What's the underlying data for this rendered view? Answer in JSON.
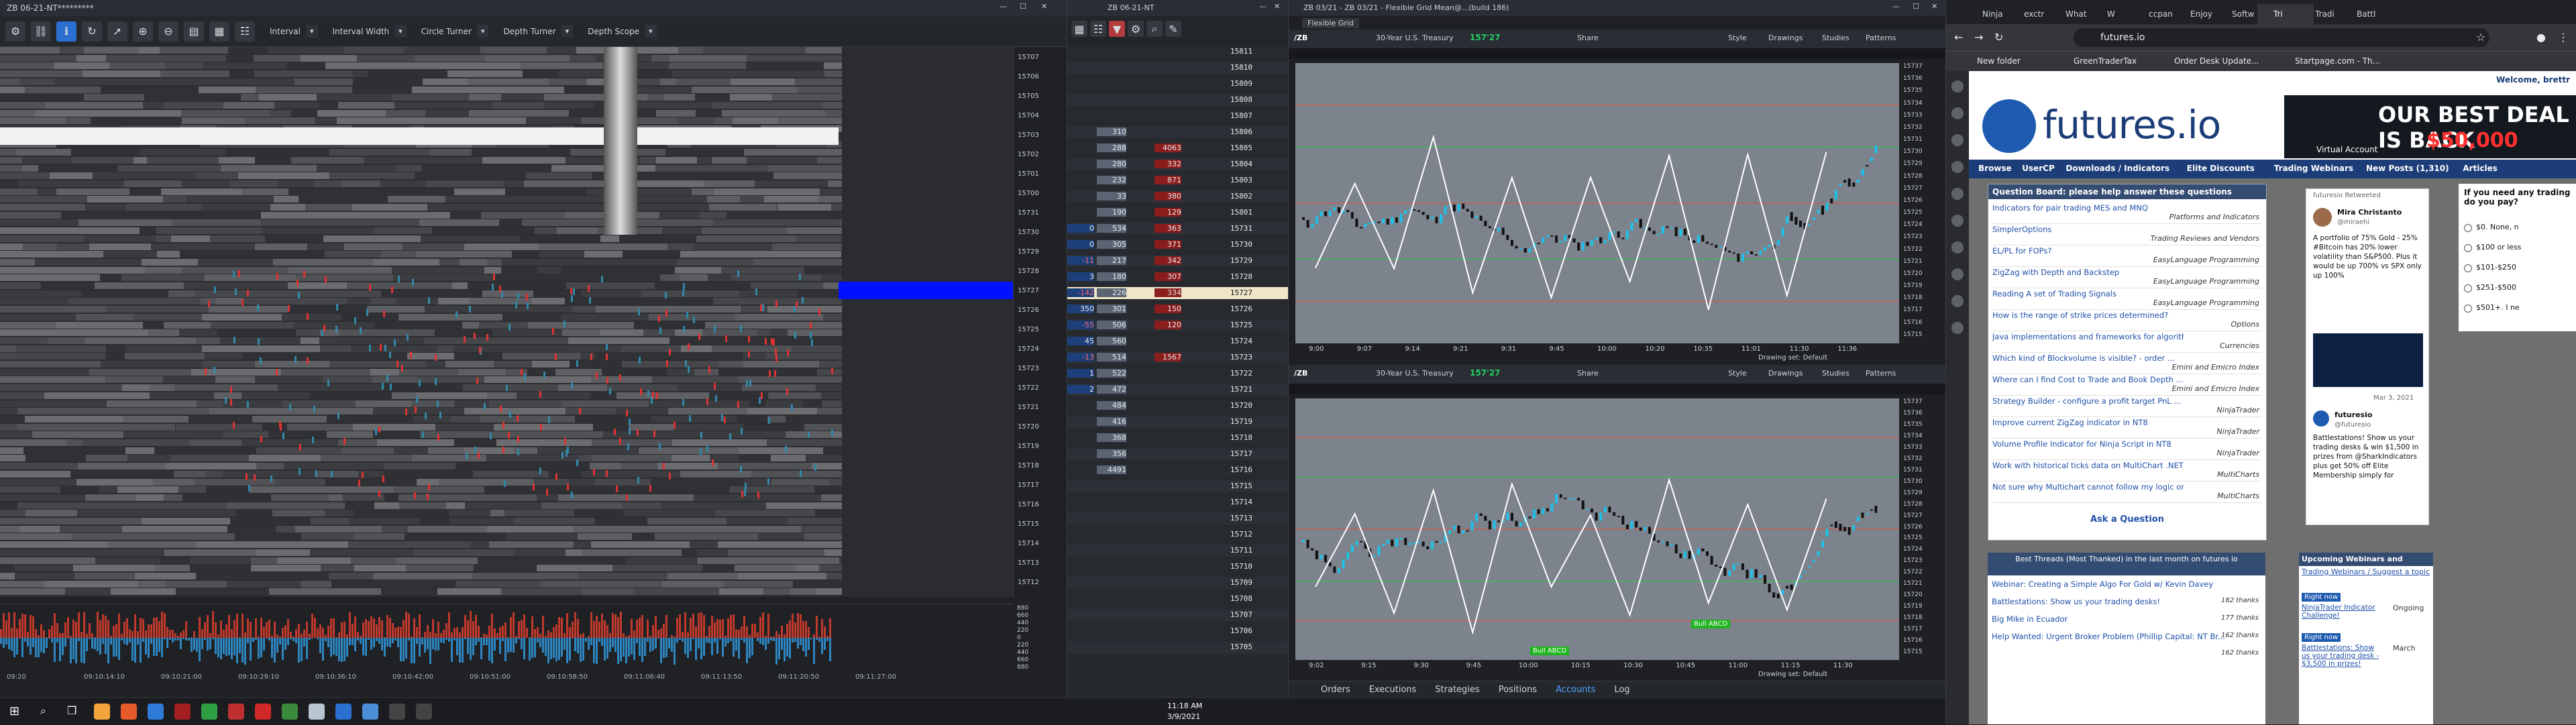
{
  "heatmap": {
    "title": "ZB 06-21-NT*********",
    "toolbar": {
      "interval_label": "Interval",
      "interval_width_label": "Interval Width",
      "circle_turner_label": "Circle Turner",
      "depth_turner_label": "Depth Turner",
      "depth_scope_label": "Depth Scope"
    },
    "price_labels": [
      "15707",
      "15706",
      "15705",
      "15704",
      "15703",
      "15702",
      "15701",
      "15700",
      "15731",
      "15730",
      "15729",
      "15728",
      "15727",
      "15726",
      "15725",
      "15724",
      "15723",
      "15722",
      "15721",
      "15720",
      "15719",
      "15718",
      "15717",
      "15716",
      "15715",
      "15714",
      "15713",
      "15712"
    ],
    "volume_labels": [
      "880",
      "660",
      "440",
      "220",
      "0",
      "220",
      "440",
      "660",
      "880"
    ],
    "time_labels": [
      "09:20",
      "09:10:14:10",
      "09:10:21:00",
      "09:10:29:10",
      "09:10:36:10",
      "09:10:42:00",
      "09:10:51:00",
      "09:10:58:50",
      "09:11:06:40",
      "09:11:13:50",
      "09:11:20:50",
      "09:11:27:00"
    ]
  },
  "ladder": {
    "title": "ZB 06-21-NT",
    "rows": [
      {
        "bid": "",
        "ask": "",
        "price": "15811"
      },
      {
        "bid": "",
        "ask": "",
        "price": "15810"
      },
      {
        "bid": "",
        "ask": "",
        "price": "15809"
      },
      {
        "bid": "",
        "ask": "",
        "price": "15808"
      },
      {
        "bid": "",
        "ask": "",
        "price": "15807"
      },
      {
        "bid": "",
        "ask": "310",
        "vol": "",
        "price": "15806"
      },
      {
        "bid": "",
        "ask": "288",
        "vol": "4063",
        "price": "15805"
      },
      {
        "bid": "",
        "ask": "280",
        "vol": "332",
        "price": "15804"
      },
      {
        "bid": "",
        "ask": "232",
        "vol": "871",
        "price": "15803"
      },
      {
        "bid": "",
        "ask": "33",
        "vol": "380",
        "price": "15802"
      },
      {
        "bid": "",
        "ask": "190",
        "vol": "129",
        "price": "15801"
      },
      {
        "bid": "0",
        "ask": "534",
        "vol": "363",
        "price": "15731"
      },
      {
        "bid": "0",
        "ask": "305",
        "vol": "371",
        "price": "15730"
      },
      {
        "bid": "-11",
        "ask": "217",
        "vol": "342",
        "price": "15729"
      },
      {
        "bid": "3",
        "ask": "180",
        "vol": "307",
        "price": "15728"
      },
      {
        "bid": "-142",
        "ask": "226",
        "vol": "334",
        "price": "15727"
      },
      {
        "bid": "350",
        "ask": "301",
        "vol": "150",
        "price": "15726"
      },
      {
        "bid": "-55",
        "ask": "506",
        "vol": "120",
        "price": "15725"
      },
      {
        "bid": "45",
        "ask": "560",
        "vol": "",
        "price": "15724"
      },
      {
        "bid": "-13",
        "ask": "514",
        "vol": "1567",
        "price": "15723"
      },
      {
        "bid": "1",
        "ask": "522",
        "vol": "",
        "price": "15722"
      },
      {
        "bid": "2",
        "ask": "472",
        "vol": "",
        "price": "15721"
      },
      {
        "bid": "",
        "ask": "484",
        "vol": "",
        "price": "15720"
      },
      {
        "bid": "",
        "ask": "416",
        "vol": "",
        "price": "15719"
      },
      {
        "bid": "",
        "ask": "368",
        "vol": "",
        "price": "15718"
      },
      {
        "bid": "",
        "ask": "356",
        "vol": "",
        "price": "15717"
      },
      {
        "bid": "",
        "ask": "4491",
        "vol": "",
        "price": "15716"
      },
      {
        "bid": "",
        "ask": "",
        "vol": "",
        "price": "15715"
      },
      {
        "bid": "",
        "ask": "",
        "vol": "",
        "price": "15714"
      },
      {
        "bid": "",
        "ask": "",
        "vol": "",
        "price": "15713"
      },
      {
        "bid": "",
        "ask": "",
        "vol": "",
        "price": "15712"
      },
      {
        "bid": "",
        "ask": "",
        "vol": "",
        "price": "15711"
      },
      {
        "bid": "",
        "ask": "",
        "vol": "",
        "price": "15710"
      },
      {
        "bid": "",
        "ask": "",
        "vol": "",
        "price": "15709"
      },
      {
        "bid": "",
        "ask": "",
        "vol": "",
        "price": "15708"
      },
      {
        "bid": "",
        "ask": "",
        "vol": "",
        "price": "15707"
      },
      {
        "bid": "",
        "ask": "",
        "vol": "",
        "price": "15706"
      },
      {
        "bid": "",
        "ask": "",
        "vol": "",
        "price": "15705"
      }
    ]
  },
  "charts": {
    "top": {
      "title": "ZB 03/21 - ZB 03/21 - Flexible Grid Mean@...(build 186)",
      "tab": "Flexible Grid",
      "symbol": "30-Year U.S. Treasury",
      "last": "157'27",
      "share": "Share",
      "style": "Style",
      "drawings": "Drawings",
      "studies": "Studies",
      "patterns": "Patterns",
      "prices": [
        "15737",
        "15736",
        "15735",
        "15734",
        "15733",
        "15732",
        "15731",
        "15730",
        "15729",
        "15728",
        "15727",
        "15726",
        "15725",
        "15724",
        "15723",
        "15722",
        "15721",
        "15720",
        "15719",
        "15718",
        "15717",
        "15716",
        "15715"
      ],
      "times": [
        "9:00",
        "9:07",
        "9:14",
        "9:21",
        "9:31",
        "9:45",
        "10:00",
        "10:20",
        "10:35",
        "11:01",
        "11:30",
        "11:36"
      ],
      "status": "Drawing set: Default"
    },
    "bottom": {
      "symbol": "30-Year U.S. Treasury",
      "last": "157'27",
      "prices": [
        "15737",
        "15736",
        "15735",
        "15734",
        "15733",
        "15732",
        "15731",
        "15730",
        "15729",
        "15728",
        "15727",
        "15726",
        "15725",
        "15724",
        "15723",
        "15722",
        "15721",
        "15720",
        "15719",
        "15718",
        "15717",
        "15716",
        "15715"
      ],
      "times": [
        "9:02",
        "9:15",
        "9:30",
        "9:45",
        "10:00",
        "10:15",
        "10:30",
        "10:45",
        "11:00",
        "11:15",
        "11:30"
      ],
      "labels": [
        "Bull ABCD",
        "Bull ABCD"
      ],
      "status": "Drawing set: Default"
    },
    "panel_tabs": [
      "Orders",
      "Executions",
      "Strategies",
      "Positions",
      "Accounts",
      "Log"
    ]
  },
  "taskbar": {
    "time": "11:18 AM",
    "date": "3/9/2021"
  },
  "browser": {
    "tabs": [
      "Ninja",
      "exctr",
      "What",
      "W",
      "ccpan",
      "Enjoy",
      "Softw",
      "Tri",
      "Tradi",
      "Battl"
    ],
    "url": "futures.io",
    "bookmarks": [
      "New folder",
      "GreenTraderTax",
      "Order Desk Update...",
      "Startpage.com - Th..."
    ],
    "site": {
      "logo": "futures.io",
      "welcome": "Welcome, brettr",
      "ad_headline": "OUR BEST DEAL IS BACK",
      "ad_price": "$50,000",
      "ad_sub": "Virtual Account",
      "nav": [
        "Browse",
        "UserCP",
        "Downloads / Indicators",
        "Elite Discounts",
        "Trading Webinars",
        "New Posts (1,310)",
        "Articles"
      ],
      "question_board_title": "Question Board: please help answer these questions",
      "questions": [
        {
          "title": "Indicators for pair trading MES and MNQ",
          "cat": "Platforms and Indicators"
        },
        {
          "title": "SimplerOptions",
          "cat": "Trading Reviews and Vendors"
        },
        {
          "title": "EL/PL for FOPs?",
          "cat": "EasyLanguage Programming"
        },
        {
          "title": "ZigZag with Depth and Backstep",
          "cat": "EasyLanguage Programming"
        },
        {
          "title": "Reading A set of Trading Signals",
          "cat": "EasyLanguage Programming"
        },
        {
          "title": "How is the range of strike prices determined?",
          "cat": "Options"
        },
        {
          "title": "Java implementations and frameworks for algorithmic ...",
          "cat": "Currencies"
        },
        {
          "title": "Which kind of Blockvolume is visible? - order ...",
          "cat": "Emini and Emicro Index"
        },
        {
          "title": "Where can I find Cost to Trade and Book Depth ...",
          "cat": "Emini and Emicro Index"
        },
        {
          "title": "Strategy Builder - configure a profit target PnL ...",
          "cat": "NinjaTrader"
        },
        {
          "title": "Improve current ZigZag indicator in NT8",
          "cat": "NinjaTrader"
        },
        {
          "title": "Volume Profile Indicator for Ninja Script in NT8",
          "cat": "NinjaTrader"
        },
        {
          "title": "Work with historical ticks data on MultiChart .NET ...",
          "cat": "MultiCharts"
        },
        {
          "title": "Not sure why Multichart cannot follow my logic on ...",
          "cat": "MultiCharts"
        }
      ],
      "ask": "Ask a Question",
      "hot_title": "Best Threads (Most Thanked) in the last month on futures io",
      "hot": [
        {
          "title": "Webinar: Creating a Simple Algo For Gold w/ Kevin Davey",
          "n": ""
        },
        {
          "title": "Battlestations: Show us your trading desks!",
          "n": "182 thanks"
        },
        {
          "title": "Big Mike in Ecuador",
          "n": "177 thanks"
        },
        {
          "title": "Help Wanted: Urgent Broker Problem (Phillip Capital: NT Br...",
          "n": "162 thanks"
        },
        {
          "title": "",
          "n": "162 thanks"
        }
      ],
      "upcoming_title": "Upcoming Webinars and Events",
      "upcoming_link": "Trading Webinars / Suggest a topic",
      "upcoming": [
        {
          "badge": "Right now",
          "title": "NinjaTrader Indicator Challenge!",
          "status": "Ongoing"
        },
        {
          "badge": "Right now",
          "title": "Battlestations: Show us your trading desk - $3,500 in prizes!",
          "status": "March"
        }
      ],
      "tweet": {
        "retweeted": "futuresio Retweeted",
        "name": "Mira Christanto",
        "handle": "@miraehi",
        "text": "A portfolio of 75% Gold - 25% #Bitcoin has 20% lower volatility than S&P500. Plus it would be up 700% vs SPX only up 100%",
        "date": "Mar 3, 2021",
        "name2": "futuresio",
        "handle2": "@futuresio",
        "text2": "Battlestations! Show us your trading desks & win $1,500 in prizes from @SharkIndicators plus get 50% off Elite Membership simply for"
      },
      "poll": {
        "q": "If you need any trading do you pay?",
        "opts": [
          "$0. None, n",
          "$100 or less",
          "$101-$250",
          "$251-$500",
          "$501+. I ne"
        ]
      }
    }
  }
}
